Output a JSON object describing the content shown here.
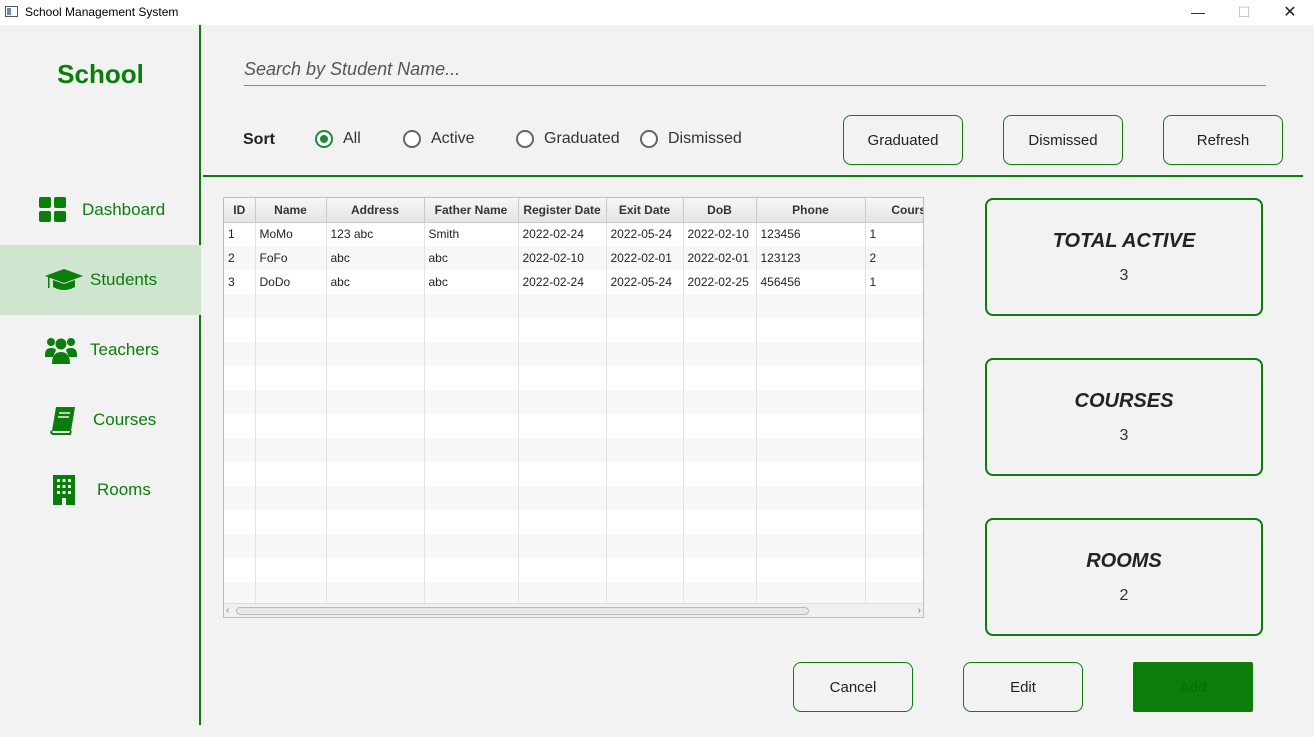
{
  "window": {
    "title": "School Management System",
    "minimize": "—",
    "maximize": "☐",
    "close": "✕"
  },
  "sidebar": {
    "brand": "School",
    "items": [
      {
        "label": "Dashboard",
        "icon": "dashboard-icon",
        "active": false
      },
      {
        "label": "Students",
        "icon": "graduation-cap-icon",
        "active": true
      },
      {
        "label": "Teachers",
        "icon": "users-icon",
        "active": false
      },
      {
        "label": "Courses",
        "icon": "book-icon",
        "active": false
      },
      {
        "label": "Rooms",
        "icon": "building-icon",
        "active": false
      }
    ]
  },
  "search": {
    "placeholder": "Search by Student Name..."
  },
  "sort": {
    "label": "Sort",
    "options": [
      {
        "label": "All",
        "checked": true
      },
      {
        "label": "Active",
        "checked": false
      },
      {
        "label": "Graduated",
        "checked": false
      },
      {
        "label": "Dismissed",
        "checked": false
      }
    ]
  },
  "filter_buttons": {
    "graduated": "Graduated",
    "dismissed": "Dismissed",
    "refresh": "Refresh"
  },
  "table": {
    "columns": [
      "ID",
      "Name",
      "Address",
      "Father Name",
      "Register Date",
      "Exit Date",
      "DoB",
      "Phone",
      "Course"
    ],
    "rows": [
      [
        "1",
        "MoMo",
        "123 abc",
        "Smith",
        "2022-02-24",
        "2022-05-24",
        "2022-02-10",
        "123456",
        "1"
      ],
      [
        "2",
        "FoFo",
        "abc",
        "abc",
        "2022-02-10",
        "2022-02-01",
        "2022-02-01",
        "123123",
        "2"
      ],
      [
        "3",
        "DoDo",
        "abc",
        "abc",
        "2022-02-24",
        "2022-05-24",
        "2022-02-25",
        "456456",
        "1"
      ]
    ]
  },
  "stats": [
    {
      "title": "TOTAL ACTIVE",
      "value": "3"
    },
    {
      "title": "COURSES",
      "value": "3"
    },
    {
      "title": "ROOMS",
      "value": "2"
    }
  ],
  "actions": {
    "cancel": "Cancel",
    "edit": "Edit",
    "add": "Add"
  },
  "colors": {
    "accent": "#0b7d0b",
    "active_nav": "#cfe5cf",
    "radio": "#1d8a3a"
  }
}
